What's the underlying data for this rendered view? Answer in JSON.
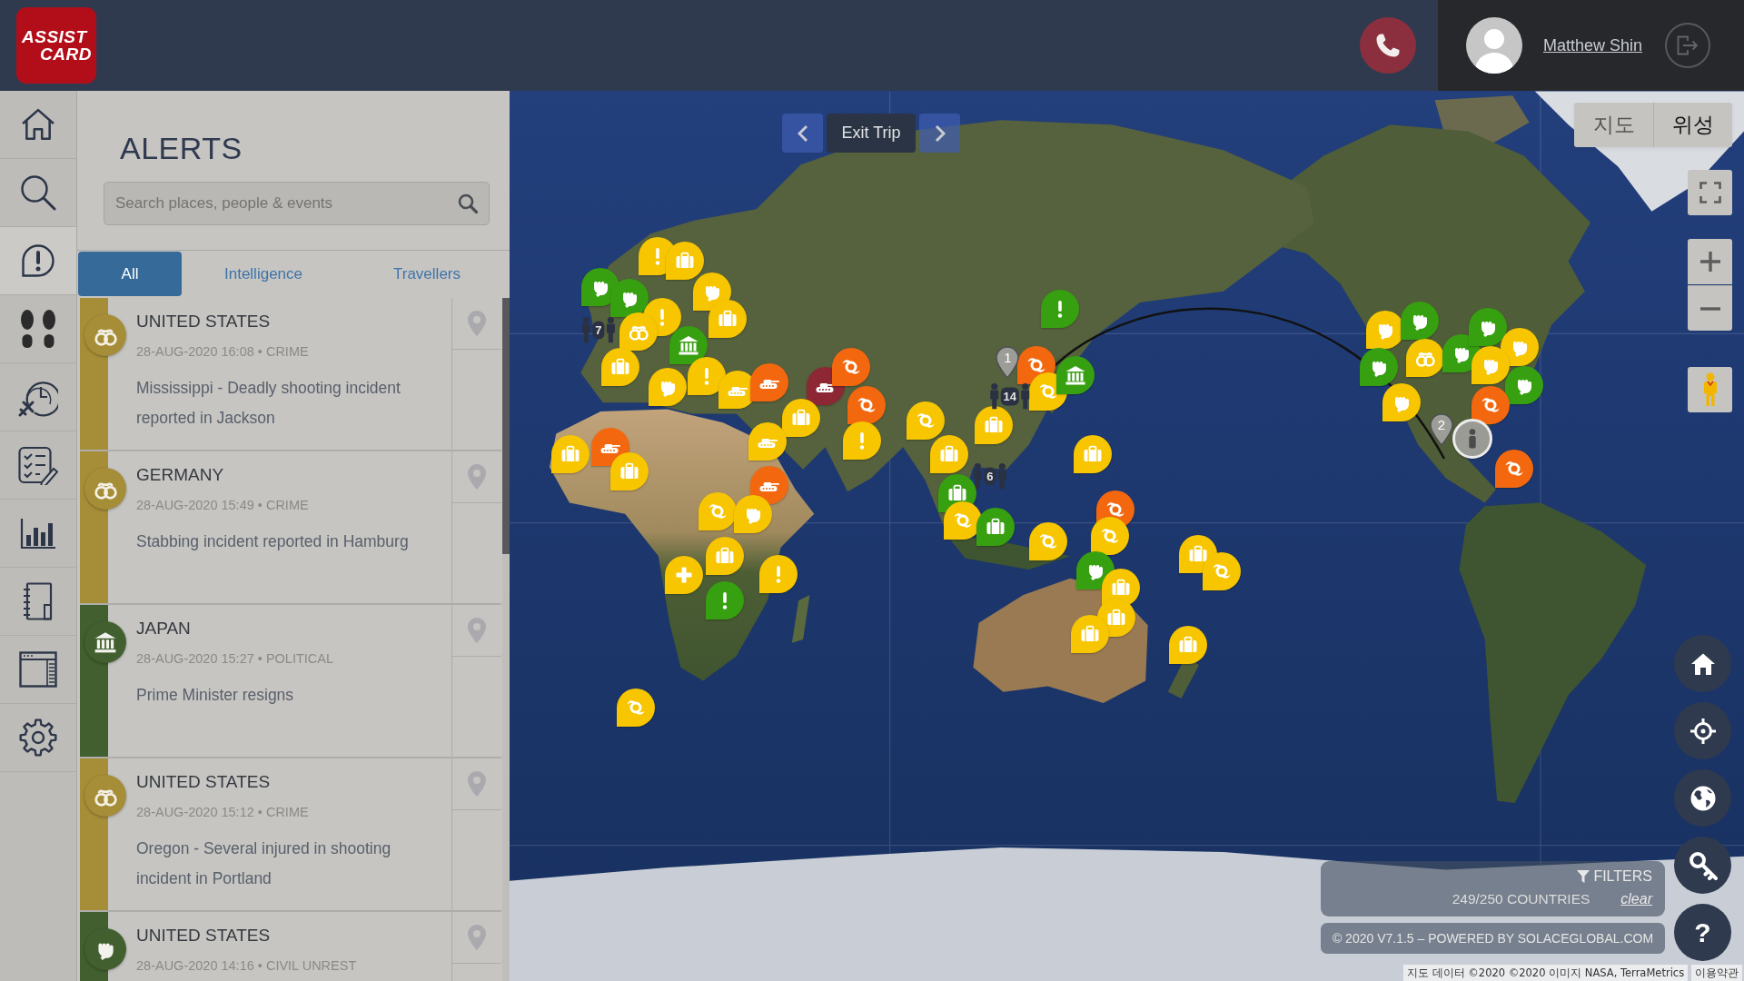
{
  "header": {
    "logo_lines": [
      "ASSIST",
      "CARD"
    ],
    "user": {
      "name": "Matthew Shin"
    }
  },
  "sidebar": {
    "items": [
      {
        "kind": "home",
        "selected": false
      },
      {
        "kind": "search",
        "selected": false
      },
      {
        "kind": "alerts",
        "selected": true
      },
      {
        "kind": "travellers",
        "selected": false
      },
      {
        "kind": "trips",
        "selected": false
      },
      {
        "kind": "checklist",
        "selected": false
      },
      {
        "kind": "reports",
        "selected": false
      },
      {
        "kind": "notebook",
        "selected": false
      },
      {
        "kind": "window",
        "selected": false
      },
      {
        "kind": "settings",
        "selected": false
      }
    ]
  },
  "alerts_panel": {
    "title": "ALERTS",
    "search": {
      "placeholder": "Search places, people & events"
    },
    "tabs": [
      {
        "label": "All",
        "selected": true
      },
      {
        "label": "Intelligence",
        "selected": false
      },
      {
        "label": "Travellers",
        "selected": false
      }
    ],
    "alerts": [
      {
        "kind": "crime",
        "color": "#a68d37",
        "country": "UNITED STATES",
        "meta": "28-AUG-2020 16:08 • CRIME",
        "description": "Mississippi - Deadly shooting incident reported in Jackson"
      },
      {
        "kind": "crime",
        "color": "#a68d37",
        "country": "GERMANY",
        "meta": "28-AUG-2020 15:49 • CRIME",
        "description": "Stabbing incident reported in Hamburg"
      },
      {
        "kind": "political",
        "color": "#415f2f",
        "country": "JAPAN",
        "meta": "28-AUG-2020 15:27 • POLITICAL",
        "description": "Prime Minister resigns"
      },
      {
        "kind": "crime",
        "color": "#a68d37",
        "country": "UNITED STATES",
        "meta": "28-AUG-2020 15:12 • CRIME",
        "description": "Oregon - Several injured in shooting incident in Portland"
      },
      {
        "kind": "civil_unrest",
        "color": "#415f2f",
        "country": "UNITED STATES",
        "meta": "28-AUG-2020 14:16 • CIVIL UNREST"
      }
    ]
  },
  "map": {
    "trip_nav": {
      "label": "Exit Trip"
    },
    "map_types": [
      {
        "label": "지도",
        "selected": false
      },
      {
        "label": "위성",
        "selected": true
      }
    ],
    "markers": [
      {
        "kind": "alert",
        "color": "#f7c600"
      },
      {
        "kind": "briefcase",
        "color": "#f7c600"
      },
      {
        "kind": "fist",
        "color": "#37a010"
      },
      {
        "kind": "fist",
        "color": "#37a010"
      },
      {
        "kind": "alert",
        "color": "#f7c600"
      },
      {
        "kind": "fist",
        "color": "#f7c600"
      },
      {
        "kind": "briefcase",
        "color": "#f7c600"
      },
      {
        "kind": "handcuffs",
        "color": "#f7c600"
      },
      {
        "kind": "building",
        "color": "#37a010"
      },
      {
        "kind": "briefcase",
        "color": "#f7c600"
      },
      {
        "kind": "fist",
        "color": "#f7c600"
      },
      {
        "kind": "alert",
        "color": "#f7c600"
      },
      {
        "kind": "tank",
        "color": "#f7c600"
      },
      {
        "kind": "tank",
        "color": "#f3680f"
      },
      {
        "kind": "tank",
        "color": "#8d2733"
      },
      {
        "kind": "cyclone",
        "color": "#f3680f"
      },
      {
        "kind": "cyclone",
        "color": "#f3680f"
      },
      {
        "kind": "briefcase",
        "color": "#f7c600"
      },
      {
        "kind": "alert",
        "color": "#f7c600"
      },
      {
        "kind": "cyclone",
        "color": "#f7c600"
      },
      {
        "kind": "briefcase",
        "color": "#f7c600"
      },
      {
        "kind": "briefcase",
        "color": "#f7c600"
      },
      {
        "kind": "cyclone",
        "color": "#f3680f"
      },
      {
        "kind": "cyclone",
        "color": "#f7c600"
      },
      {
        "kind": "building",
        "color": "#37a010"
      },
      {
        "kind": "alert",
        "color": "#37a010"
      },
      {
        "kind": "briefcase",
        "color": "#f7c600"
      },
      {
        "kind": "tank",
        "color": "#f7c600"
      },
      {
        "kind": "briefcase",
        "color": "#f7c600"
      },
      {
        "kind": "tank",
        "color": "#f3680f"
      },
      {
        "kind": "briefcase",
        "color": "#f7c600"
      },
      {
        "kind": "tank",
        "color": "#f3680f"
      },
      {
        "kind": "cyclone",
        "color": "#f7c600"
      },
      {
        "kind": "fist",
        "color": "#f7c600"
      },
      {
        "kind": "briefcase",
        "color": "#f7c600"
      },
      {
        "kind": "plus",
        "color": "#f7c600"
      },
      {
        "kind": "alert",
        "color": "#37a010"
      },
      {
        "kind": "alert",
        "color": "#f7c600"
      },
      {
        "kind": "cyclone",
        "color": "#f7c600"
      },
      {
        "kind": "briefcase",
        "color": "#37a010"
      },
      {
        "kind": "cyclone",
        "color": "#f7c600"
      },
      {
        "kind": "briefcase",
        "color": "#37a010"
      },
      {
        "kind": "cyclone",
        "color": "#f7c600"
      },
      {
        "kind": "cyclone",
        "color": "#f3680f"
      },
      {
        "kind": "cyclone",
        "color": "#f7c600"
      },
      {
        "kind": "fist",
        "color": "#37a010"
      },
      {
        "kind": "briefcase",
        "color": "#f7c600"
      },
      {
        "kind": "briefcase",
        "color": "#f7c600"
      },
      {
        "kind": "briefcase",
        "color": "#f7c600"
      },
      {
        "kind": "briefcase",
        "color": "#f7c600"
      },
      {
        "kind": "cyclone",
        "color": "#f7c600"
      },
      {
        "kind": "briefcase",
        "color": "#f7c600"
      },
      {
        "kind": "fist",
        "color": "#f7c600"
      },
      {
        "kind": "fist",
        "color": "#37a010"
      },
      {
        "kind": "fist",
        "color": "#37a010"
      },
      {
        "kind": "handcuffs",
        "color": "#f7c600"
      },
      {
        "kind": "fist",
        "color": "#37a010"
      },
      {
        "kind": "fist",
        "color": "#f7c600"
      },
      {
        "kind": "fist",
        "color": "#37a010"
      },
      {
        "kind": "fist",
        "color": "#f7c600"
      },
      {
        "kind": "fist",
        "color": "#f7c600"
      },
      {
        "kind": "fist",
        "color": "#37a010"
      },
      {
        "kind": "cyclone",
        "color": "#f3680f"
      },
      {
        "kind": "cyclone",
        "color": "#f3680f"
      },
      {
        "kind": "person",
        "color": "#9b9b96"
      }
    ],
    "clusters": [
      {
        "kind": "travellers",
        "count": "7"
      },
      {
        "kind": "travellers",
        "count": "14"
      },
      {
        "kind": "travellers",
        "count": "6"
      },
      {
        "kind": "pin",
        "count": "1"
      },
      {
        "kind": "pin",
        "count": "2"
      }
    ],
    "help_label": "?",
    "filters": {
      "label": "FILTERS",
      "countries": "249/250 COUNTRIES",
      "clear": "clear"
    },
    "version": "© 2020 V7.1.5 – POWERED BY SOLACEGLOBAL.COM",
    "attribution": "지도 데이터 ©2020 ©2020 이미지 NASA, TerraMetrics",
    "terms": "이용약관"
  }
}
